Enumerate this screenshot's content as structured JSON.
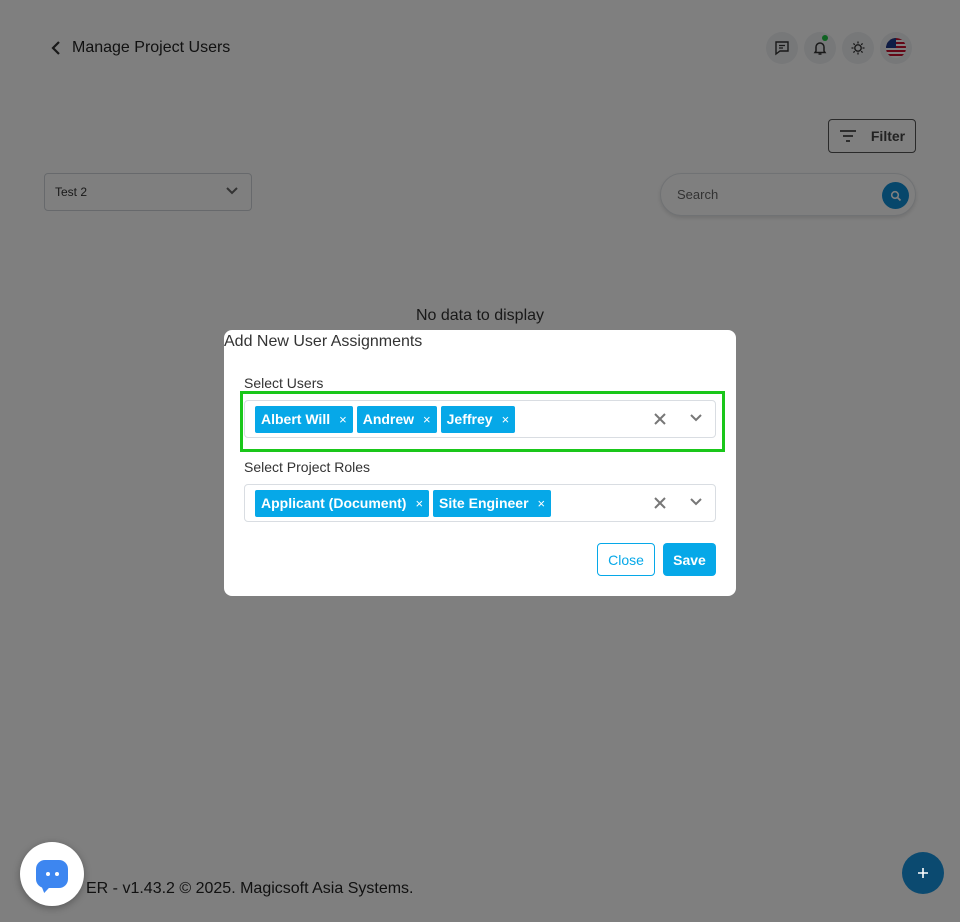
{
  "header": {
    "title": "Manage Project Users",
    "icons": [
      "chevron-left-icon",
      "chat-icon",
      "bell-icon",
      "sun-icon",
      "us-flag-icon"
    ],
    "notification_dot_color": "#1ec745"
  },
  "toolbar": {
    "filter_label": "Filter",
    "project_select_value": "Test 2",
    "search_placeholder": "Search"
  },
  "table": {
    "empty_message": "No data to display"
  },
  "footer": {
    "text": "ER - v1.43.2 © 2025. Magicsoft Asia Systems."
  },
  "modal": {
    "title": "Add New User Assignments",
    "users_label": "Select Users",
    "selected_users": [
      "Albert Will",
      "Andrew",
      "Jeffrey"
    ],
    "roles_label": "Select Project Roles",
    "selected_roles": [
      "Applicant (Document)",
      "Site Engineer"
    ],
    "chip_remove_glyph": "×",
    "close_label": "Close",
    "save_label": "Save"
  },
  "colors": {
    "accent": "#06a8e8",
    "highlight": "#1ac71a",
    "search_button": "#0f8ed6",
    "chat_fab": "#3d86f0",
    "add_fab": "#0b4a70"
  }
}
